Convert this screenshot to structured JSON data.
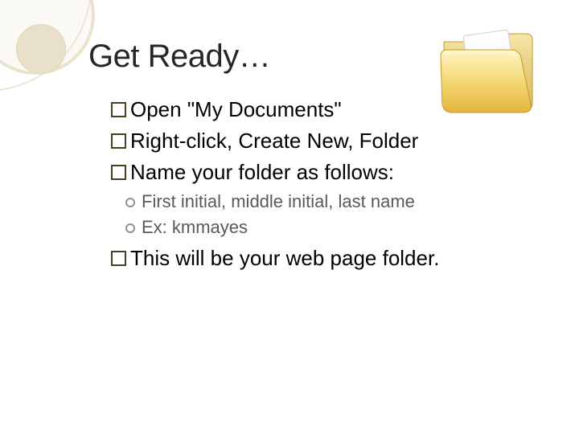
{
  "title": "Get Ready…",
  "bullets": {
    "b0": "Open \"My Documents\"",
    "b1": "Right-click, Create New, Folder",
    "b2": "Name your folder as follows:",
    "s0": "First initial, middle initial, last name",
    "s1": "Ex: kmmayes",
    "b3": "This will be your web page folder."
  },
  "icon": {
    "name": "open-folder-icon"
  }
}
